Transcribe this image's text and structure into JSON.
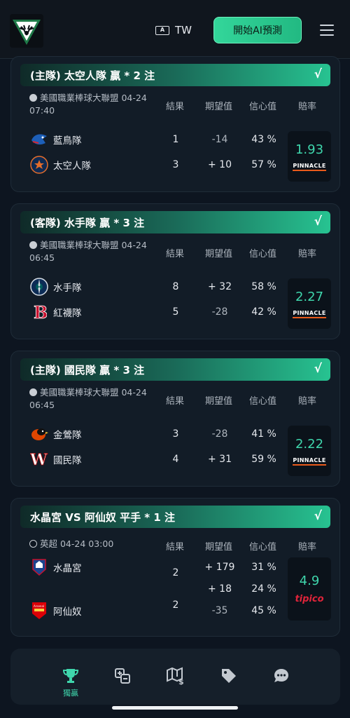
{
  "header": {
    "lang_icon": "A",
    "lang": "TW",
    "ai_button": "開始AI預測",
    "menu_icon": "hamburger-icon"
  },
  "columns": [
    "結果",
    "期望值",
    "信心值",
    "賠率"
  ],
  "cards": [
    {
      "banner": "(主隊) 太空人隊 贏 * 2 注",
      "check": "√",
      "league": "美國職業棒球大聯盟 04-24 07:40",
      "teams": [
        {
          "name": "藍鳥隊",
          "result": "1",
          "ev": "-14",
          "conf": "43 %"
        },
        {
          "name": "太空人隊",
          "result": "3",
          "ev": "+ 10",
          "conf": "57 %"
        }
      ],
      "odds": "1.93",
      "bookmaker": "PINNACLE"
    },
    {
      "banner": "(客隊) 水手隊 贏 * 3 注",
      "check": "√",
      "league": "美國職業棒球大聯盟 04-24 06:45",
      "teams": [
        {
          "name": "水手隊",
          "result": "8",
          "ev": "+ 32",
          "conf": "58 %"
        },
        {
          "name": "紅襪隊",
          "result": "5",
          "ev": "-28",
          "conf": "42 %"
        }
      ],
      "odds": "2.27",
      "bookmaker": "PINNACLE"
    },
    {
      "banner": "(主隊) 國民隊 贏 * 3 注",
      "check": "√",
      "league": "美國職業棒球大聯盟 04-24 06:45",
      "teams": [
        {
          "name": "金鶯隊",
          "result": "3",
          "ev": "-28",
          "conf": "41 %"
        },
        {
          "name": "國民隊",
          "result": "4",
          "ev": "+ 31",
          "conf": "59 %"
        }
      ],
      "odds": "2.22",
      "bookmaker": "PINNACLE"
    },
    {
      "banner": "水晶宮 VS 阿仙奴 平手 * 1 注",
      "check": "√",
      "league": "英超 04-24 03:00",
      "teams": [
        {
          "name": "水晶宮",
          "result": "2"
        },
        {
          "name": "阿仙奴",
          "result": "2"
        }
      ],
      "ev": [
        "+ 179",
        "+ 18",
        "-35"
      ],
      "conf": [
        "31 %",
        "24 %",
        "45 %"
      ],
      "odds": "4.9",
      "bookmaker": "tipico"
    }
  ],
  "nav": {
    "items": [
      "trophy-icon",
      "swap-icon",
      "map-dollar-icon",
      "tag-icon",
      "chat-icon"
    ],
    "active_label": "獨贏"
  },
  "colors": {
    "accent": "#3fd6ac",
    "background": "#0d1520",
    "card": "#121c27"
  }
}
